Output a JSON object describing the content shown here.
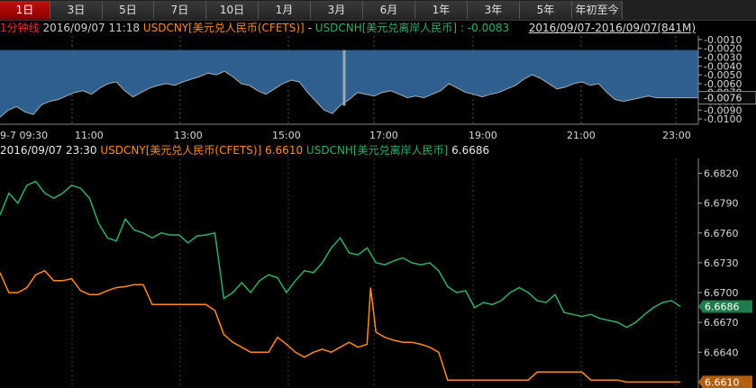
{
  "tabs": [
    {
      "label": "1日",
      "active": true
    },
    {
      "label": "3日",
      "active": false
    },
    {
      "label": "5日",
      "active": false
    },
    {
      "label": "7日",
      "active": false
    },
    {
      "label": "10日",
      "active": false
    },
    {
      "label": "1月",
      "active": false
    },
    {
      "label": "3月",
      "active": false
    },
    {
      "label": "6月",
      "active": false
    },
    {
      "label": "1年",
      "active": false
    },
    {
      "label": "3年",
      "active": false
    },
    {
      "label": "5年",
      "active": false
    },
    {
      "label": "年初至今",
      "active": false
    }
  ],
  "info1": {
    "mode_label": "1分钟线",
    "datetime": "2016/09/07 11:18",
    "series_a": "USDCNY[美元兑人民币(CFETS)]",
    "separator": "-",
    "series_b": "USDCNH[美元兑离岸人民币]",
    "value": ": -0.0083",
    "date_range": "2016/09/07-2016/09/07(841M)"
  },
  "info2": {
    "datetime": "2016/09/07 23:30",
    "cny_label": "USDCNY[美元兑人民币(CFETS)]",
    "cny_value": "6.6610",
    "cnh_label": "USDCNH[美元兑离岸人民币]",
    "cnh_value": "6.6686"
  },
  "chart_data": [
    {
      "type": "area",
      "y_ticks": [
        "-0.0010",
        "-0.0020",
        "-0.0030",
        "-0.0040",
        "-0.0050",
        "-0.0060",
        "-0.0070",
        "-0.0080",
        "-0.0090",
        "-0.0100"
      ],
      "ylim": [
        -0.0106,
        -0.0006
      ],
      "x_ticks": [
        "9-7 09:30",
        "11:00",
        "13:00",
        "15:00",
        "17:00",
        "19:00",
        "21:00",
        "23:00"
      ],
      "last_value_tag": "-0.0076",
      "series": [
        {
          "name": "USDCNY - USDCNH",
          "x": [
            0,
            10,
            20,
            30,
            40,
            50,
            60,
            70,
            80,
            90,
            100,
            110,
            120,
            130,
            140,
            150,
            160,
            170,
            180,
            190,
            200,
            210,
            220,
            230,
            240,
            250,
            260,
            270,
            280,
            290,
            300,
            310,
            320,
            330,
            340,
            350,
            360,
            370,
            380,
            390,
            400,
            410,
            420,
            430,
            440,
            450,
            460,
            470,
            480,
            490,
            500,
            510,
            520,
            530,
            540,
            550,
            560,
            570,
            580,
            590,
            600,
            610,
            620,
            630,
            640,
            650,
            660,
            670,
            680,
            690,
            700,
            710,
            720,
            730,
            740,
            750,
            760,
            770,
            780,
            790,
            800,
            810,
            820,
            830,
            840
          ],
          "values": [
            -0.0098,
            -0.009,
            -0.0086,
            -0.0092,
            -0.0095,
            -0.0084,
            -0.008,
            -0.0078,
            -0.0074,
            -0.007,
            -0.0068,
            -0.0072,
            -0.0065,
            -0.006,
            -0.0058,
            -0.0068,
            -0.0075,
            -0.007,
            -0.0065,
            -0.0062,
            -0.006,
            -0.0062,
            -0.0058,
            -0.0055,
            -0.0052,
            -0.0048,
            -0.005,
            -0.0046,
            -0.0052,
            -0.006,
            -0.0062,
            -0.0068,
            -0.0072,
            -0.0066,
            -0.006,
            -0.0056,
            -0.0058,
            -0.007,
            -0.008,
            -0.009,
            -0.0094,
            -0.0084,
            -0.0078,
            -0.007,
            -0.0072,
            -0.0074,
            -0.007,
            -0.0068,
            -0.0072,
            -0.0076,
            -0.0074,
            -0.0076,
            -0.0072,
            -0.0068,
            -0.006,
            -0.0065,
            -0.007,
            -0.0072,
            -0.0075,
            -0.0072,
            -0.007,
            -0.0066,
            -0.0062,
            -0.0055,
            -0.005,
            -0.0054,
            -0.006,
            -0.0066,
            -0.0064,
            -0.006,
            -0.0058,
            -0.0062,
            -0.006,
            -0.007,
            -0.0078,
            -0.008,
            -0.0078,
            -0.0076,
            -0.0074,
            -0.0076,
            -0.0076,
            -0.0076,
            -0.0076,
            -0.0076,
            -0.0076
          ]
        }
      ],
      "spike_x": 414
    },
    {
      "type": "line",
      "y_ticks": [
        "6.6820",
        "6.6790",
        "6.6760",
        "6.6730",
        "6.6700",
        "6.6670",
        "6.6640"
      ],
      "ylim": [
        6.6604,
        6.6835
      ],
      "series": [
        {
          "name": "USDCNH",
          "color": "#2fb06a",
          "x": [
            0,
            10,
            20,
            30,
            40,
            50,
            60,
            70,
            80,
            90,
            100,
            110,
            120,
            130,
            140,
            150,
            160,
            170,
            180,
            190,
            200,
            210,
            220,
            230,
            240,
            250,
            260,
            270,
            280,
            290,
            300,
            310,
            320,
            330,
            340,
            350,
            360,
            370,
            380,
            390,
            400,
            410,
            420,
            430,
            440,
            450,
            460,
            470,
            480,
            490,
            500,
            510,
            520,
            530,
            540,
            550,
            560,
            570,
            580,
            590,
            600,
            610,
            620,
            630,
            640,
            650,
            660,
            670,
            680,
            690,
            700,
            710,
            720,
            730,
            740,
            750,
            760
          ],
          "values": [
            6.6778,
            6.68,
            6.679,
            6.6808,
            6.6812,
            6.68,
            6.6795,
            6.68,
            6.6808,
            6.6805,
            6.6795,
            6.677,
            6.6755,
            6.6752,
            6.6774,
            6.6763,
            6.676,
            6.6755,
            6.676,
            6.6758,
            6.6758,
            6.675,
            6.6757,
            6.6758,
            6.676,
            6.6694,
            6.67,
            6.671,
            6.67,
            6.6712,
            6.6718,
            6.6715,
            6.67,
            6.6712,
            6.6722,
            6.672,
            6.673,
            6.6745,
            6.6755,
            6.674,
            6.6738,
            6.6745,
            6.673,
            6.6728,
            6.6732,
            6.6735,
            6.673,
            6.6728,
            6.673,
            6.6722,
            6.6706,
            6.67,
            6.6702,
            6.6685,
            6.669,
            6.6688,
            6.6692,
            6.67,
            6.6705,
            6.67,
            6.6692,
            6.669,
            6.6698,
            6.668,
            6.6678,
            6.6676,
            6.6678,
            6.6674,
            6.6672,
            6.667,
            6.6665,
            6.667,
            6.6678,
            6.6685,
            6.669,
            6.6692,
            6.6686
          ]
        },
        {
          "name": "USDCNY",
          "color": "#ff8c1a",
          "x": [
            0,
            10,
            20,
            30,
            40,
            50,
            60,
            70,
            80,
            90,
            100,
            110,
            120,
            130,
            140,
            150,
            160,
            170,
            180,
            190,
            200,
            210,
            220,
            230,
            240,
            250,
            260,
            270,
            280,
            290,
            300,
            310,
            320,
            330,
            340,
            350,
            360,
            370,
            380,
            390,
            400,
            410,
            414,
            420,
            430,
            440,
            450,
            460,
            470,
            480,
            490,
            500,
            510,
            520,
            530,
            540,
            550,
            560,
            570,
            580,
            590,
            600,
            610,
            620,
            630,
            640,
            650,
            660,
            670,
            680,
            690,
            700,
            710,
            720,
            730,
            740,
            750,
            760
          ],
          "values": [
            6.672,
            6.67,
            6.67,
            6.6705,
            6.6718,
            6.6722,
            6.6712,
            6.6712,
            6.6714,
            6.6702,
            6.6698,
            6.6698,
            6.6702,
            6.6705,
            6.6706,
            6.6708,
            6.6708,
            6.6688,
            6.6688,
            6.6688,
            6.6688,
            6.6688,
            6.6688,
            6.6688,
            6.6682,
            6.6658,
            6.665,
            6.6645,
            6.664,
            6.664,
            6.664,
            6.6655,
            6.6648,
            6.664,
            6.6635,
            6.664,
            6.6643,
            6.664,
            6.6645,
            6.665,
            6.6645,
            6.6648,
            6.6705,
            6.666,
            6.6655,
            6.6652,
            6.665,
            6.665,
            6.6648,
            6.6645,
            6.664,
            6.6612,
            6.6612,
            6.6612,
            6.6612,
            6.6612,
            6.6612,
            6.6612,
            6.6612,
            6.6612,
            6.6612,
            6.662,
            6.662,
            6.662,
            6.662,
            6.662,
            6.662,
            6.6612,
            6.6612,
            6.6612,
            6.6612,
            6.661,
            6.661,
            6.661,
            6.661,
            6.661,
            6.661,
            6.661
          ]
        }
      ],
      "last_value_tags": {
        "cnh": "6.6686",
        "cny": "6.6610"
      }
    }
  ]
}
